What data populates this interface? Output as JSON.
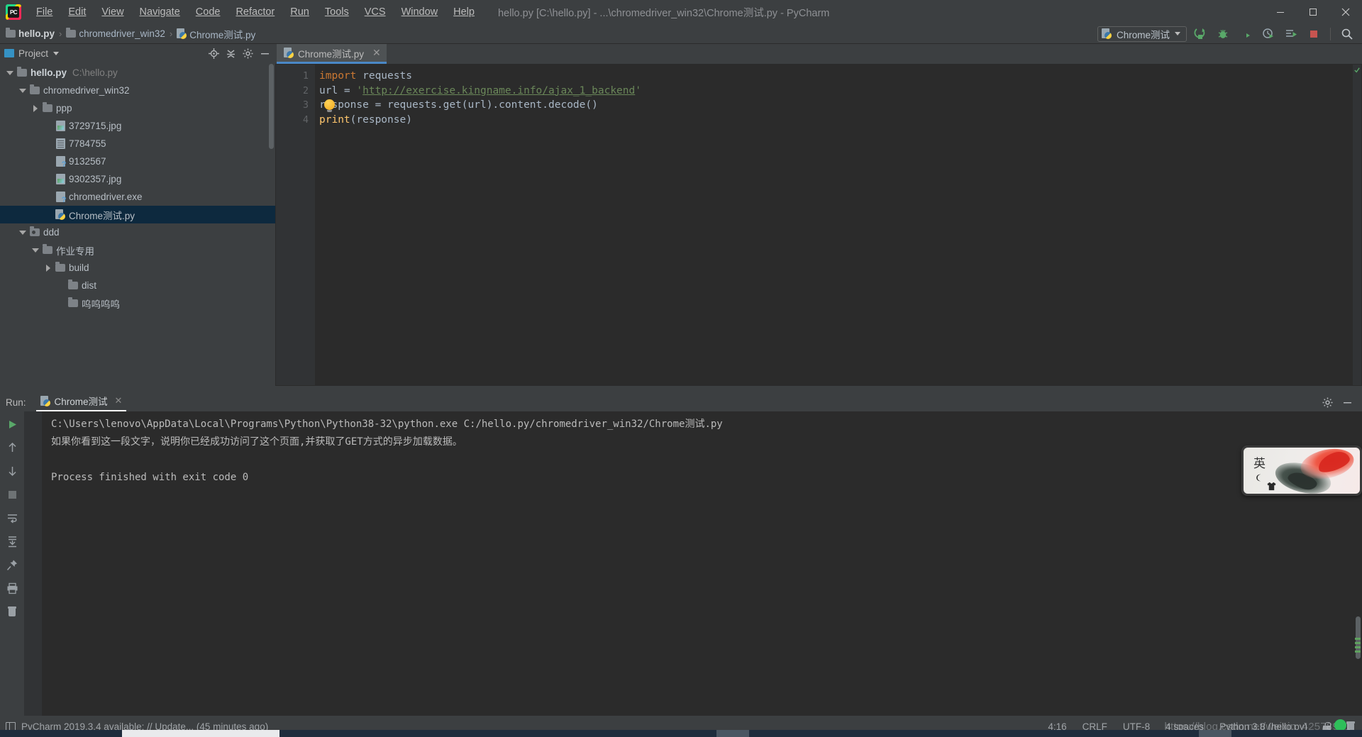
{
  "titlebar": {
    "window_title": "hello.py [C:\\hello.py] - ...\\chromedriver_win32\\Chrome测试.py - PyCharm",
    "menus": [
      "File",
      "Edit",
      "View",
      "Navigate",
      "Code",
      "Refactor",
      "Run",
      "Tools",
      "VCS",
      "Window",
      "Help"
    ],
    "minimize": "–",
    "maximize": "❐",
    "close": "✕"
  },
  "breadcrumb": {
    "items": [
      {
        "label": "hello.py",
        "icon": "folder-icon",
        "bold": true
      },
      {
        "label": "chromedriver_win32",
        "icon": "folder-icon",
        "bold": false
      },
      {
        "label": "Chrome测试.py",
        "icon": "python-file-icon",
        "bold": false
      }
    ],
    "separator": "›"
  },
  "run_config": {
    "name": "Chrome测试",
    "icons": [
      "run-icon",
      "debug-icon",
      "coverage-icon",
      "profile-icon",
      "run-with-console-icon",
      "stop-icon",
      "search-everywhere-icon"
    ]
  },
  "project_panel": {
    "title": "Project",
    "header_icons": [
      "locate-icon",
      "collapse-all-icon",
      "settings-gear-icon",
      "hide-icon"
    ],
    "tree": [
      {
        "label": "hello.py",
        "path": "C:\\hello.py",
        "indent": 0,
        "twisty": "down",
        "icon": "folder-icon",
        "bold": true,
        "selected": false
      },
      {
        "label": "chromedriver_win32",
        "path": "",
        "indent": 1,
        "twisty": "down",
        "icon": "folder-icon",
        "bold": false,
        "selected": false
      },
      {
        "label": "ppp",
        "path": "",
        "indent": 2,
        "twisty": "right",
        "icon": "folder-icon",
        "bold": false,
        "selected": false
      },
      {
        "label": "3729715.jpg",
        "path": "",
        "indent": 3,
        "twisty": "none",
        "icon": "image-file-icon",
        "bold": false,
        "selected": false
      },
      {
        "label": "7784755",
        "path": "",
        "indent": 3,
        "twisty": "none",
        "icon": "text-file-icon",
        "bold": false,
        "selected": false
      },
      {
        "label": "9132567",
        "path": "",
        "indent": 3,
        "twisty": "none",
        "icon": "unknown-file-icon",
        "bold": false,
        "selected": false
      },
      {
        "label": "9302357.jpg",
        "path": "",
        "indent": 3,
        "twisty": "none",
        "icon": "image-file-icon",
        "bold": false,
        "selected": false
      },
      {
        "label": "chromedriver.exe",
        "path": "",
        "indent": 3,
        "twisty": "none",
        "icon": "unknown-file-icon",
        "bold": false,
        "selected": false
      },
      {
        "label": "Chrome测试.py",
        "path": "",
        "indent": 3,
        "twisty": "none",
        "icon": "python-file-icon",
        "bold": false,
        "selected": true
      },
      {
        "label": "ddd",
        "path": "",
        "indent": 1,
        "twisty": "down",
        "icon": "module-folder-icon",
        "bold": false,
        "selected": false
      },
      {
        "label": "作业专用",
        "path": "",
        "indent": 2,
        "twisty": "down",
        "icon": "folder-icon",
        "bold": false,
        "selected": false
      },
      {
        "label": "build",
        "path": "",
        "indent": 3,
        "twisty": "right",
        "icon": "folder-icon",
        "bold": false,
        "selected": false
      },
      {
        "label": "dist",
        "path": "",
        "indent": 4,
        "twisty": "none",
        "icon": "folder-icon",
        "bold": false,
        "selected": false
      },
      {
        "label": "呜呜呜呜",
        "path": "",
        "indent": 4,
        "twisty": "none",
        "icon": "folder-icon",
        "bold": false,
        "selected": false
      }
    ]
  },
  "editor": {
    "tab": {
      "label": "Chrome测试.py",
      "close": "✕",
      "icon": "python-file-icon"
    },
    "line_numbers": [
      "1",
      "2",
      "3",
      "4"
    ],
    "code": {
      "l1_kw": "import",
      "l1_rest": " requests",
      "l2_pre": "url = ",
      "l2_quote": "'",
      "l2_url": "http://exercise.kingname.info/ajax_1_backend",
      "l2_quote2": "'",
      "l3": "response = requests.get(url).content.decode()",
      "l4_fn": "print",
      "l4_rest": "(response)"
    }
  },
  "run_panel": {
    "label": "Run:",
    "tab_name": "Chrome测试",
    "tab_close": "✕",
    "toolbar_icons": [
      "rerun-icon",
      "scroll-up-icon",
      "scroll-down-icon",
      "stop-icon",
      "print-icon",
      "soft-wrap-icon",
      "scroll-to-end-icon",
      "pin-icon",
      "trash-icon"
    ],
    "header_icons": [
      "settings-gear-icon",
      "hide-icon"
    ],
    "console_lines": [
      "C:\\Users\\lenovo\\AppData\\Local\\Programs\\Python\\Python38-32\\python.exe C:/hello.py/chromedriver_win32/Chrome测试.py",
      "如果你看到这一段文字，说明你已经成功访问了这个页面,并获取了GET方式的异步加载数据。",
      "",
      "Process finished with exit code 0"
    ]
  },
  "statusbar": {
    "message": "PyCharm 2019.3.4 available: // Update... (45 minutes ago)",
    "caret_position": "4:16",
    "line_separator": "CRLF",
    "encoding": "UTF-8",
    "indent": "4 spaces",
    "python_interpreter": "Python 3.8 (hello.py)",
    "lock_icon": "lock-icon",
    "trash_icon": "trash-icon"
  },
  "ime_widget": {
    "mode_label": "英",
    "moon_icon": "moon-icon",
    "shirt_icon": "shirt-icon",
    "image": "koi-fish-art"
  },
  "watermark": {
    "text": "https://blog.csdn.net/weixin_42578981"
  },
  "colors": {
    "accent_blue": "#4a88c7",
    "selection": "#0d293e",
    "editor_bg": "#2b2b2b",
    "panel_bg": "#3c3f41",
    "keyword_orange": "#cc7832",
    "string_green": "#6a8759",
    "function_yellow": "#ffc66d",
    "text": "#a9b7c6",
    "run_green": "#59a869",
    "stop_red": "#c75450"
  }
}
